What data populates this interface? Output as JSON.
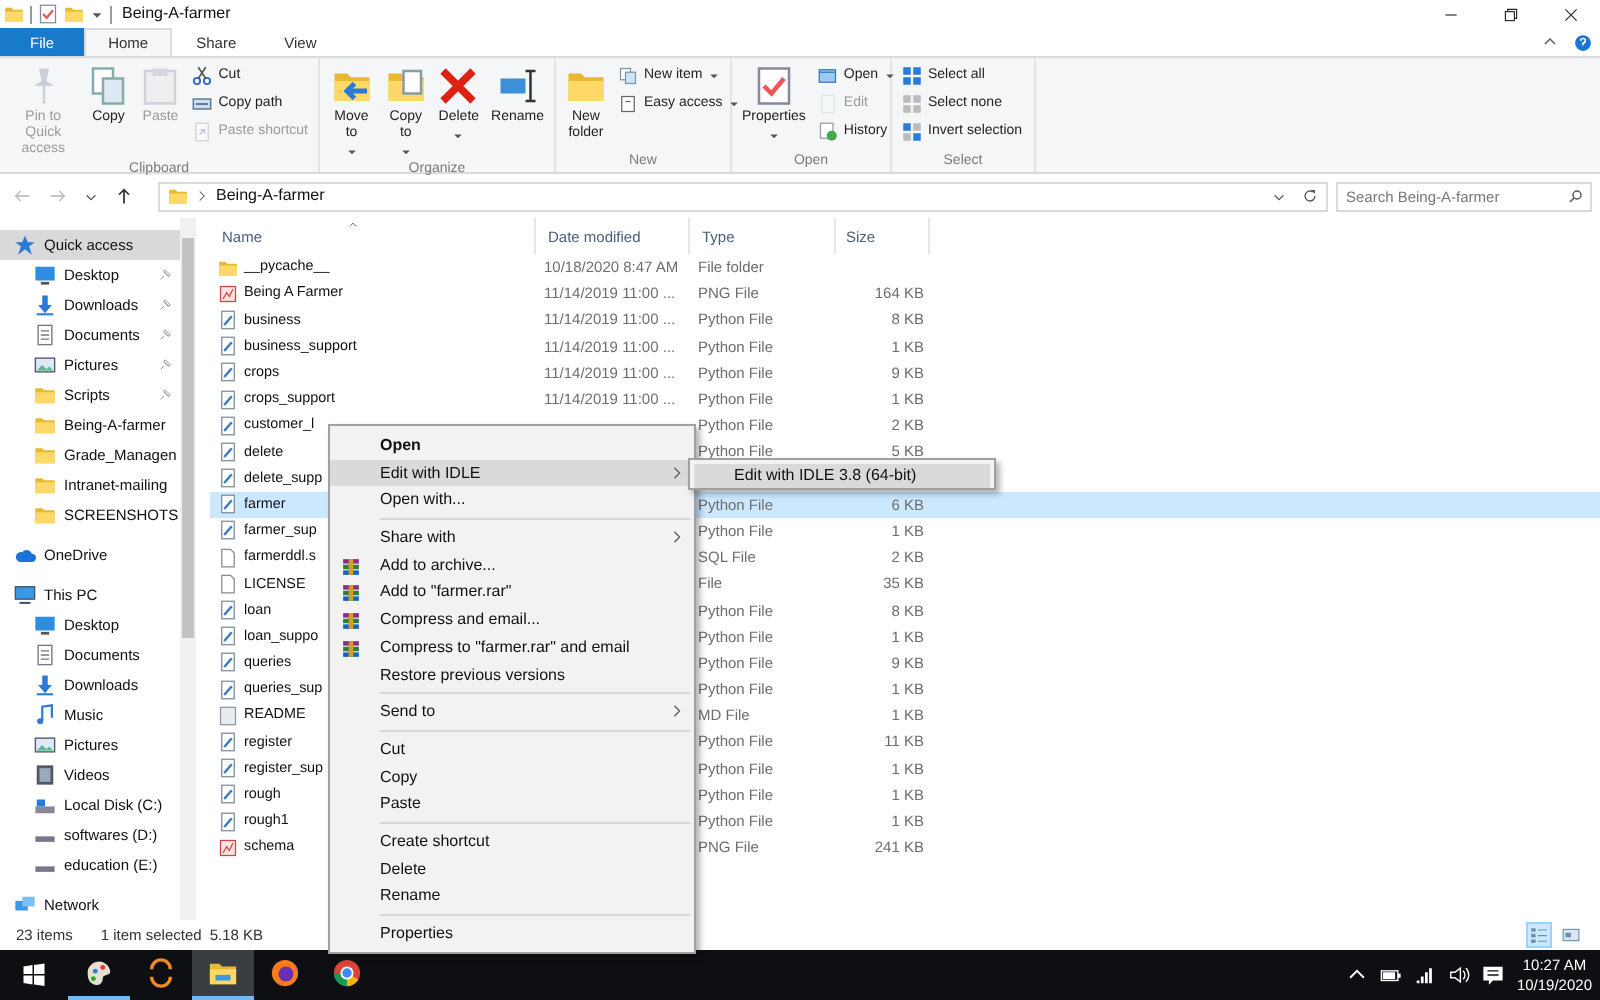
{
  "window": {
    "title": "Being-A-farmer"
  },
  "ribbon_tabs": [
    {
      "label": "File",
      "kind": "file",
      "selected": false
    },
    {
      "label": "Home",
      "kind": "tab",
      "selected": true
    },
    {
      "label": "Share",
      "kind": "tab",
      "selected": false
    },
    {
      "label": "View",
      "kind": "tab",
      "selected": false
    }
  ],
  "ribbon_groups": [
    {
      "label": "Clipboard",
      "buttons": [
        {
          "label": "Pin to Quick access",
          "kind": "large",
          "disabled": true,
          "dropdown": false
        },
        {
          "label": "Copy",
          "kind": "large",
          "disabled": false,
          "dropdown": false
        },
        {
          "label": "Paste",
          "kind": "large",
          "disabled": true,
          "dropdown": false
        },
        {
          "label": "Cut",
          "kind": "small",
          "disabled": false,
          "dropdown": false
        },
        {
          "label": "Copy path",
          "kind": "small",
          "disabled": false,
          "dropdown": false
        },
        {
          "label": "Paste shortcut",
          "kind": "small",
          "disabled": true,
          "dropdown": false
        }
      ]
    },
    {
      "label": "Organize",
      "buttons": [
        {
          "label": "Move to",
          "kind": "large",
          "disabled": false,
          "dropdown": true
        },
        {
          "label": "Copy to",
          "kind": "large",
          "disabled": false,
          "dropdown": true
        },
        {
          "label": "Delete",
          "kind": "large",
          "disabled": false,
          "dropdown": true
        },
        {
          "label": "Rename",
          "kind": "large",
          "disabled": false,
          "dropdown": false
        }
      ]
    },
    {
      "label": "New",
      "buttons": [
        {
          "label": "New folder",
          "kind": "large",
          "disabled": false,
          "dropdown": false
        },
        {
          "label": "New item",
          "kind": "small",
          "disabled": false,
          "dropdown": true
        },
        {
          "label": "Easy access",
          "kind": "small",
          "disabled": false,
          "dropdown": true
        }
      ]
    },
    {
      "label": "Open",
      "buttons": [
        {
          "label": "Properties",
          "kind": "large",
          "disabled": false,
          "dropdown": true
        },
        {
          "label": "Open",
          "kind": "small",
          "disabled": false,
          "dropdown": true
        },
        {
          "label": "Edit",
          "kind": "small",
          "disabled": true,
          "dropdown": false
        },
        {
          "label": "History",
          "kind": "small",
          "disabled": false,
          "dropdown": false
        }
      ]
    },
    {
      "label": "Select",
      "buttons": [
        {
          "label": "Select all",
          "kind": "small",
          "disabled": false,
          "dropdown": false
        },
        {
          "label": "Select none",
          "kind": "small",
          "disabled": false,
          "dropdown": false
        },
        {
          "label": "Invert selection",
          "kind": "small",
          "disabled": false,
          "dropdown": false
        }
      ]
    }
  ],
  "navigation": [
    {
      "kind": "back",
      "disabled": true
    },
    {
      "kind": "forward",
      "disabled": true
    },
    {
      "kind": "recent",
      "disabled": false
    },
    {
      "kind": "up",
      "disabled": false
    }
  ],
  "address": {
    "path": "Being-A-farmer"
  },
  "search": {
    "placeholder": "Search Being-A-farmer"
  },
  "sidebar": {
    "items": [
      {
        "label": "Quick access",
        "kind": "star",
        "selected": true,
        "pinned": false,
        "children": [
          {
            "label": "Desktop",
            "kind": "desktop",
            "selected": false,
            "pinned": true
          },
          {
            "label": "Downloads",
            "kind": "download",
            "selected": false,
            "pinned": true
          },
          {
            "label": "Documents",
            "kind": "documents",
            "selected": false,
            "pinned": true
          },
          {
            "label": "Pictures",
            "kind": "pictures",
            "selected": false,
            "pinned": true
          },
          {
            "label": "Scripts",
            "kind": "folder",
            "selected": false,
            "pinned": true
          },
          {
            "label": "Being-A-farmer",
            "kind": "folder",
            "selected": false,
            "pinned": false
          },
          {
            "label": "Grade_Managen",
            "kind": "folder",
            "selected": false,
            "pinned": false
          },
          {
            "label": "Intranet-mailing",
            "kind": "folder",
            "selected": false,
            "pinned": false
          },
          {
            "label": "SCREENSHOTS",
            "kind": "folder",
            "selected": false,
            "pinned": false
          }
        ]
      },
      {
        "label": "OneDrive",
        "kind": "cloud",
        "selected": false,
        "pinned": false
      },
      {
        "label": "This PC",
        "kind": "pc",
        "selected": false,
        "pinned": false,
        "children": [
          {
            "label": "Desktop",
            "kind": "desktop",
            "selected": false,
            "pinned": false
          },
          {
            "label": "Documents",
            "kind": "documents",
            "selected": false,
            "pinned": false
          },
          {
            "label": "Downloads",
            "kind": "download",
            "selected": false,
            "pinned": false
          },
          {
            "label": "Music",
            "kind": "music",
            "selected": false,
            "pinned": false
          },
          {
            "label": "Pictures",
            "kind": "pictures",
            "selected": false,
            "pinned": false
          },
          {
            "label": "Videos",
            "kind": "video",
            "selected": false,
            "pinned": false
          },
          {
            "label": "Local Disk (C:)",
            "kind": "disk",
            "selected": false,
            "pinned": false
          },
          {
            "label": "softwares (D:)",
            "kind": "drive",
            "selected": false,
            "pinned": false
          },
          {
            "label": "education (E:)",
            "kind": "drive",
            "selected": false,
            "pinned": false
          }
        ]
      },
      {
        "label": "Network",
        "kind": "network",
        "selected": false,
        "pinned": false
      }
    ]
  },
  "file_list": {
    "columns": [
      "Name",
      "Date modified",
      "Type",
      "Size"
    ],
    "rows": [
      {
        "name": "__pycache__",
        "date": "10/18/2020 8:47 AM",
        "type": "File folder",
        "kind": "folder",
        "selected": false
      },
      {
        "name": "Being  A  Farmer",
        "date": "11/14/2019 11:00 ...",
        "type": "PNG File",
        "size": "164 KB",
        "kind": "image",
        "selected": false
      },
      {
        "name": "business",
        "date": "11/14/2019 11:00 ...",
        "type": "Python File",
        "size": "8 KB",
        "kind": "python",
        "selected": false
      },
      {
        "name": "business_support",
        "date": "11/14/2019 11:00 ...",
        "type": "Python File",
        "size": "1 KB",
        "kind": "python",
        "selected": false
      },
      {
        "name": "crops",
        "date": "11/14/2019 11:00 ...",
        "type": "Python File",
        "size": "9 KB",
        "kind": "python",
        "selected": false
      },
      {
        "name": "crops_support",
        "date": "11/14/2019 11:00 ...",
        "type": "Python File",
        "size": "1 KB",
        "kind": "python",
        "selected": false
      },
      {
        "name": "customer_l",
        "type": "Python File",
        "size": "2 KB",
        "kind": "python",
        "selected": false
      },
      {
        "name": "delete",
        "type": "Python File",
        "size": "5 KB",
        "kind": "python",
        "selected": false
      },
      {
        "name": "delete_supp",
        "kind": "python",
        "selected": false
      },
      {
        "name": "farmer",
        "type": "Python File",
        "size": "6 KB",
        "kind": "python",
        "selected": true
      },
      {
        "name": "farmer_sup",
        "type": "Python File",
        "size": "1 KB",
        "kind": "python",
        "selected": false
      },
      {
        "name": "farmerddl.s",
        "type": "SQL File",
        "size": "2 KB",
        "kind": "file",
        "selected": false
      },
      {
        "name": "LICENSE",
        "type": "File",
        "size": "35 KB",
        "kind": "file",
        "selected": false
      },
      {
        "name": "loan",
        "type": "Python File",
        "size": "8 KB",
        "kind": "python",
        "selected": false
      },
      {
        "name": "loan_suppo",
        "type": "Python File",
        "size": "1 KB",
        "kind": "python",
        "selected": false
      },
      {
        "name": "queries",
        "type": "Python File",
        "size": "9 KB",
        "kind": "python",
        "selected": false
      },
      {
        "name": "queries_sup",
        "type": "Python File",
        "size": "1 KB",
        "kind": "python",
        "selected": false
      },
      {
        "name": "README",
        "type": "MD File",
        "size": "1 KB",
        "kind": "text",
        "selected": false
      },
      {
        "name": "register",
        "type": "Python File",
        "size": "11 KB",
        "kind": "python",
        "selected": false
      },
      {
        "name": "register_sup",
        "type": "Python File",
        "size": "1 KB",
        "kind": "python",
        "selected": false
      },
      {
        "name": "rough",
        "type": "Python File",
        "size": "1 KB",
        "kind": "python",
        "selected": false
      },
      {
        "name": "rough1",
        "type": "Python File",
        "size": "1 KB",
        "kind": "python",
        "selected": false
      },
      {
        "name": "schema",
        "type": "PNG File",
        "size": "241 KB",
        "kind": "image",
        "selected": false
      }
    ]
  },
  "context_menu": {
    "items": [
      {
        "label": "Open",
        "kind": "item",
        "default": true,
        "selected": false,
        "submenu": false
      },
      {
        "label": "Edit with IDLE",
        "kind": "item",
        "default": false,
        "selected": true,
        "submenu": true
      },
      {
        "label": "Open with...",
        "kind": "item",
        "default": false,
        "selected": false,
        "submenu": false
      },
      {
        "kind": "separator"
      },
      {
        "label": "Share with",
        "kind": "item",
        "default": false,
        "selected": false,
        "submenu": true
      },
      {
        "label": "Add to archive...",
        "kind": "archive",
        "default": false,
        "selected": false,
        "submenu": false
      },
      {
        "label": "Add to \"farmer.rar\"",
        "kind": "archive",
        "default": false,
        "selected": false,
        "submenu": false
      },
      {
        "label": "Compress and email...",
        "kind": "archive",
        "default": false,
        "selected": false,
        "submenu": false
      },
      {
        "label": "Compress to \"farmer.rar\" and email",
        "kind": "archive",
        "default": false,
        "selected": false,
        "submenu": false
      },
      {
        "label": "Restore previous versions",
        "kind": "item",
        "default": false,
        "selected": false,
        "submenu": false
      },
      {
        "kind": "separator"
      },
      {
        "label": "Send to",
        "kind": "item",
        "default": false,
        "selected": false,
        "submenu": true
      },
      {
        "kind": "separator"
      },
      {
        "label": "Cut",
        "kind": "item",
        "default": false,
        "selected": false,
        "submenu": false
      },
      {
        "label": "Copy",
        "kind": "item",
        "default": false,
        "selected": false,
        "submenu": false
      },
      {
        "label": "Paste",
        "kind": "item",
        "default": false,
        "selected": false,
        "submenu": false
      },
      {
        "kind": "separator"
      },
      {
        "label": "Create shortcut",
        "kind": "item",
        "default": false,
        "selected": false,
        "submenu": false
      },
      {
        "label": "Delete",
        "kind": "item",
        "default": false,
        "selected": false,
        "submenu": false
      },
      {
        "label": "Rename",
        "kind": "item",
        "default": false,
        "selected": false,
        "submenu": false
      },
      {
        "kind": "separator"
      },
      {
        "label": "Properties",
        "kind": "item",
        "default": false,
        "selected": false,
        "submenu": false
      }
    ]
  },
  "submenu": {
    "items": [
      {
        "label": "Edit with IDLE 3.8 (64-bit)"
      }
    ]
  },
  "status_bar": {
    "item_count": "23 items",
    "selection": "1 item selected",
    "selection_size": "5.18 KB",
    "view_buttons": [
      {
        "kind": "details",
        "selected": true
      },
      {
        "kind": "tiles",
        "selected": false
      }
    ]
  },
  "taskbar": {
    "apps": [
      {
        "kind": "paint",
        "running": true,
        "active": false
      },
      {
        "kind": "sync",
        "running": false,
        "active": false
      },
      {
        "kind": "explorer",
        "running": true,
        "active": true
      },
      {
        "kind": "firefox",
        "running": false,
        "active": false
      },
      {
        "kind": "chrome",
        "running": false,
        "active": false
      }
    ],
    "time": "10:27 AM",
    "date": "10/19/2020"
  }
}
